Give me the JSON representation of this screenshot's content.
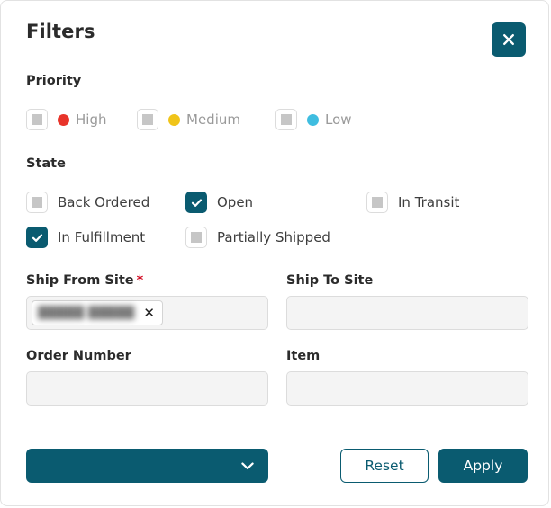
{
  "panel": {
    "title": "Filters",
    "close_icon": "close-x-icon"
  },
  "priority": {
    "label": "Priority",
    "options": [
      {
        "label": "High",
        "checked": false,
        "disabled": true,
        "dot_color": "#e8342a",
        "dot_icon": "priority-dot-high"
      },
      {
        "label": "Medium",
        "checked": false,
        "disabled": true,
        "dot_color": "#f0c419",
        "dot_icon": "priority-dot-medium"
      },
      {
        "label": "Low",
        "checked": false,
        "disabled": true,
        "dot_color": "#3fbde0",
        "dot_icon": "priority-dot-low"
      }
    ]
  },
  "state": {
    "label": "State",
    "options": [
      {
        "label": "Back Ordered",
        "checked": false
      },
      {
        "label": "Open",
        "checked": true
      },
      {
        "label": "In Transit",
        "checked": false
      },
      {
        "label": "In Fulfillment",
        "checked": true
      },
      {
        "label": "Partially Shipped",
        "checked": false
      }
    ]
  },
  "fields": {
    "ship_from_site": {
      "label": "Ship From Site",
      "required_marker": "*",
      "value": "",
      "placeholder": "",
      "token": {
        "text": "█████   █████",
        "remove_icon": "remove-token-x-icon",
        "remove_label": "✕"
      }
    },
    "ship_to_site": {
      "label": "Ship To Site",
      "value": "",
      "placeholder": ""
    },
    "order_number": {
      "label": "Order Number",
      "value": "",
      "placeholder": ""
    },
    "item": {
      "label": "Item",
      "value": "",
      "placeholder": ""
    }
  },
  "footer": {
    "select": {
      "value": "",
      "chevron_icon": "chevron-down-icon"
    },
    "reset_label": "Reset",
    "apply_label": "Apply"
  },
  "colors": {
    "accent_teal": "#0a5b70",
    "required_red": "#d0021b",
    "priority_high": "#e8342a",
    "priority_medium": "#f0c419",
    "priority_low": "#3fbde0"
  }
}
